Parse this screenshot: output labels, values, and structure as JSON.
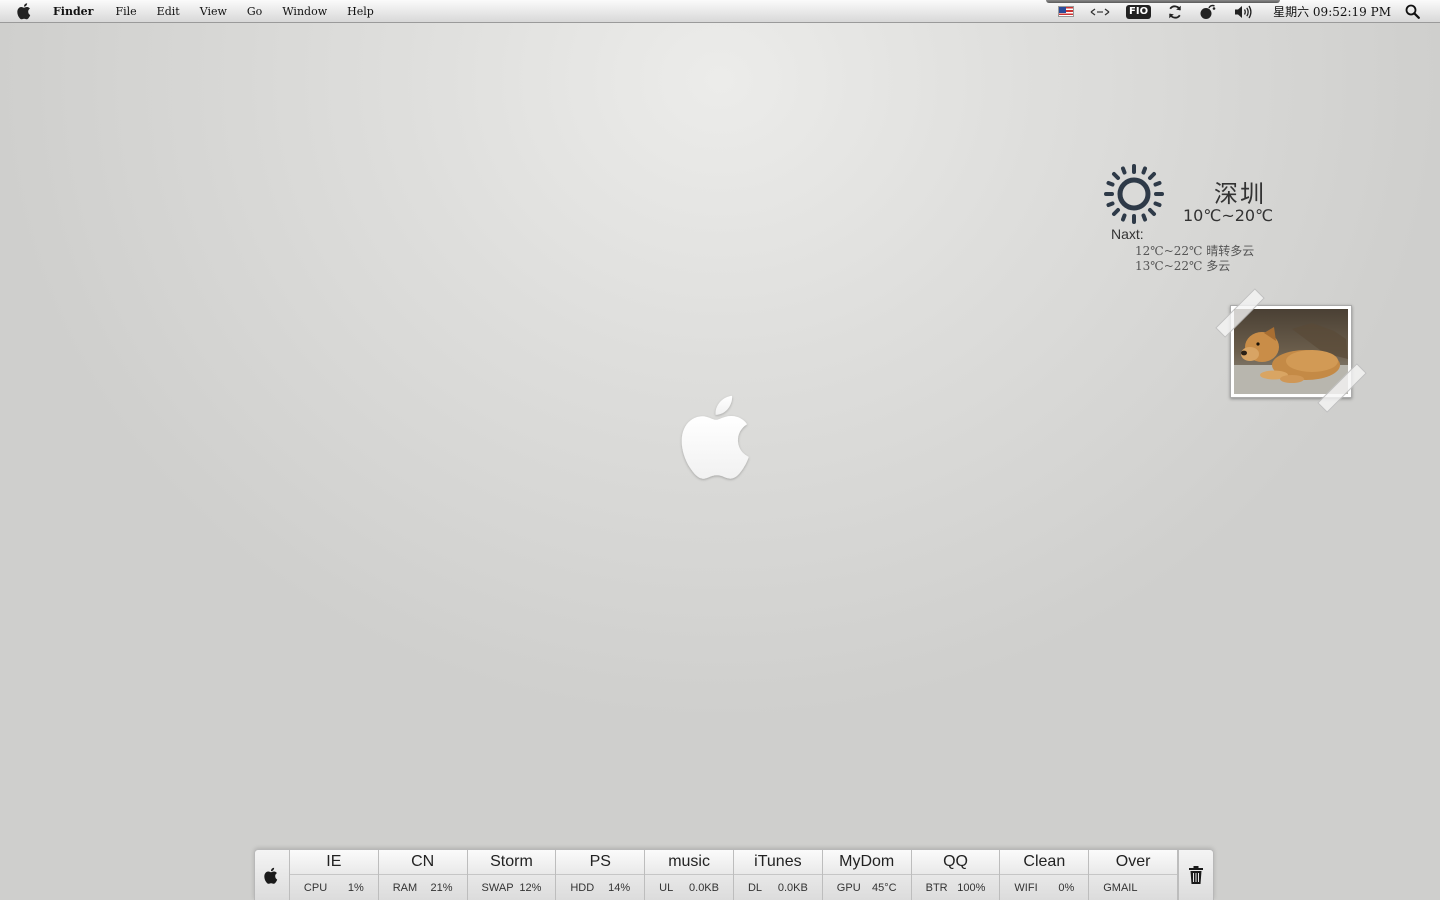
{
  "menubar": {
    "items": [
      "Finder",
      "File",
      "Edit",
      "View",
      "Go",
      "Window",
      "Help"
    ],
    "tray": {
      "flag_icon": "us-flag-icon",
      "network_icon": "network-arrows-icon",
      "fio_label": "FIO",
      "sync_icon": "sync-icon",
      "bluetooth_icon": "status-icon",
      "volume_icon": "volume-icon",
      "clock": "星期六 09:52:19 PM",
      "search_icon": "spotlight-search-icon"
    }
  },
  "weather": {
    "icon": "sun-icon",
    "city": "深圳",
    "temp": "10℃~20℃",
    "next_label": "Naxt:",
    "forecast": [
      "12℃~22℃ 晴转多云",
      "13℃~22℃ 多云"
    ]
  },
  "photo": {
    "subject": "dog-photo"
  },
  "dock": {
    "cells": [
      {
        "app": "IE",
        "stat_label": "CPU",
        "stat_value": "1%"
      },
      {
        "app": "CN",
        "stat_label": "RAM",
        "stat_value": "21%"
      },
      {
        "app": "Storm",
        "stat_label": "SWAP",
        "stat_value": "12%"
      },
      {
        "app": "PS",
        "stat_label": "HDD",
        "stat_value": "14%"
      },
      {
        "app": "music",
        "stat_label": "UL",
        "stat_value": "0.0KB"
      },
      {
        "app": "iTunes",
        "stat_label": "DL",
        "stat_value": "0.0KB"
      },
      {
        "app": "MyDom",
        "stat_label": "GPU",
        "stat_value": "45°C"
      },
      {
        "app": "QQ",
        "stat_label": "BTR",
        "stat_value": "100%"
      },
      {
        "app": "Clean",
        "stat_label": "WIFI",
        "stat_value": "0%"
      },
      {
        "app": "Over",
        "stat_label": "GMAIL",
        "stat_value": ""
      }
    ]
  },
  "colors": {
    "desktop": "#dededc",
    "menubar": "#e6e6e6",
    "dock": "#e8e8e8",
    "weather_icon": "#2e3a48"
  }
}
